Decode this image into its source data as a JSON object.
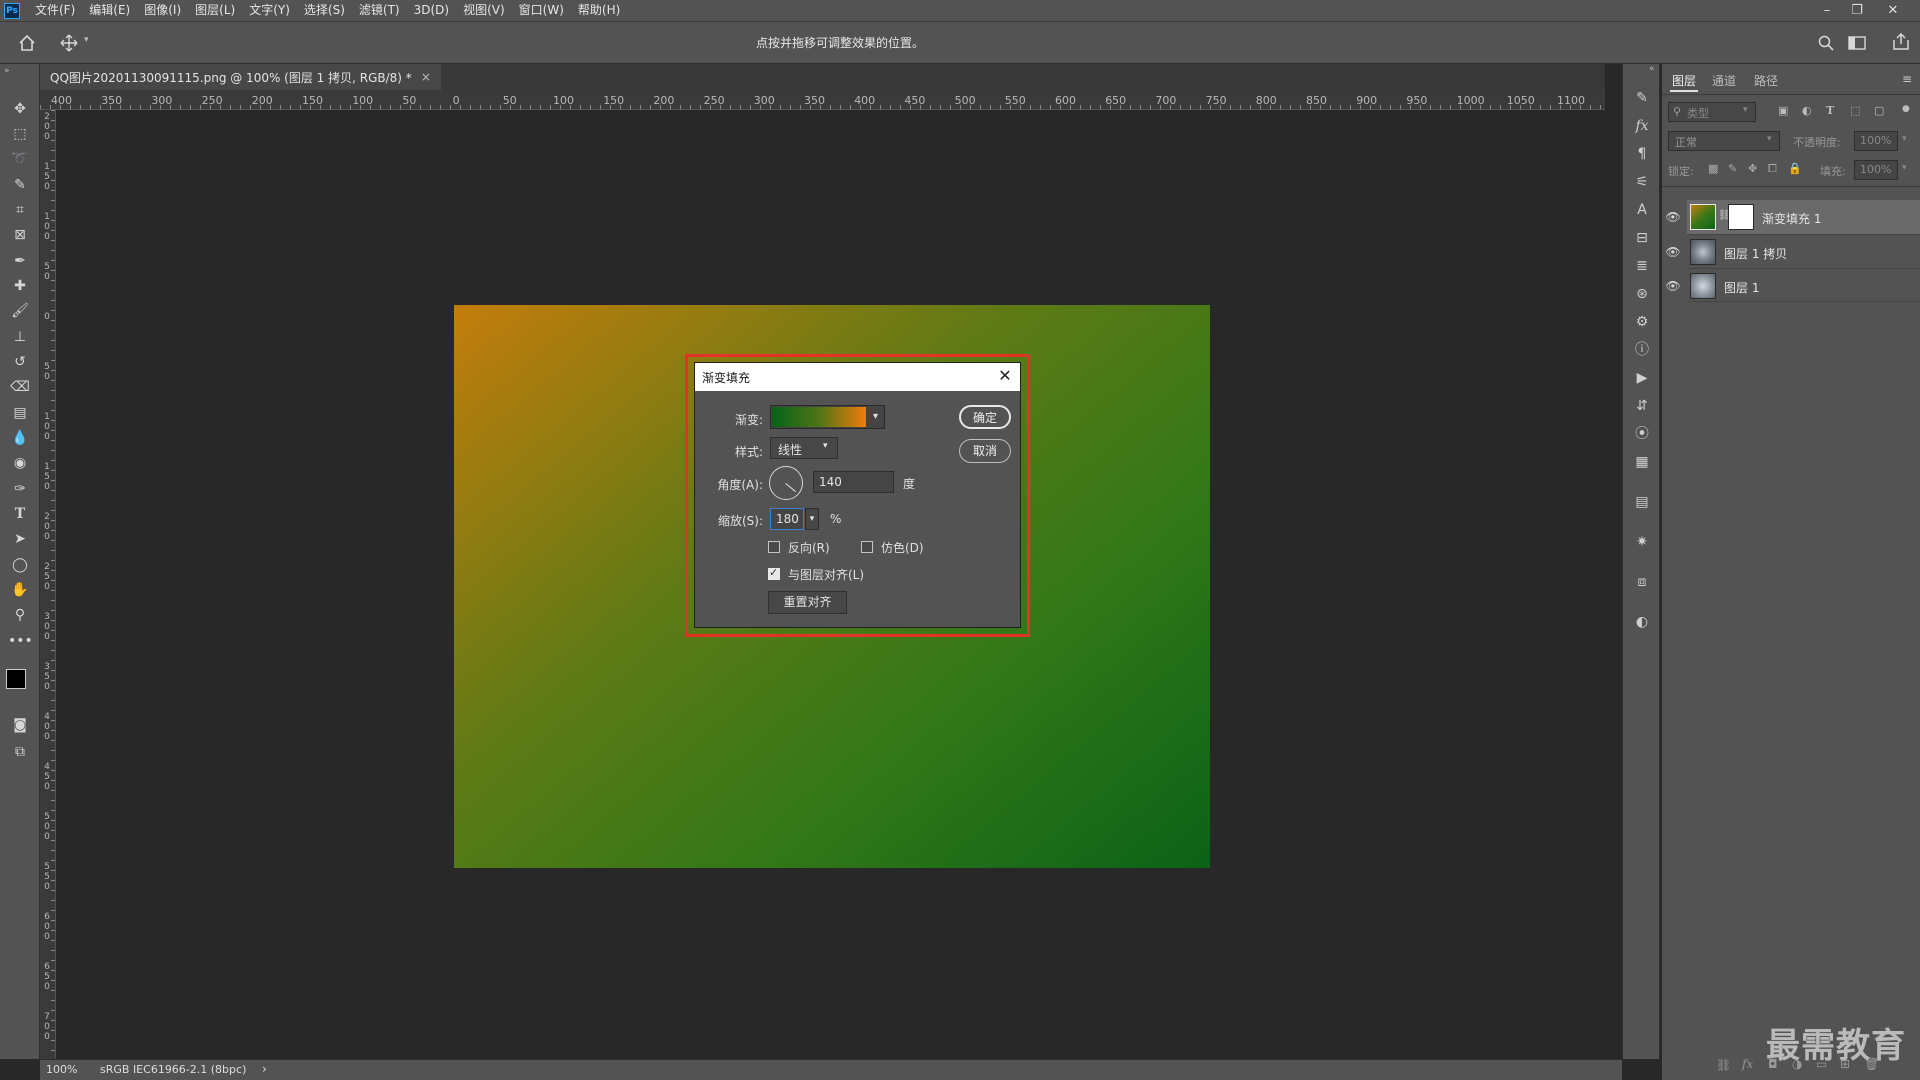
{
  "app": {
    "logo": "Ps",
    "menu": [
      "文件(F)",
      "编辑(E)",
      "图像(I)",
      "图层(L)",
      "文字(Y)",
      "选择(S)",
      "滤镜(T)",
      "3D(D)",
      "视图(V)",
      "窗口(W)",
      "帮助(H)"
    ],
    "window_controls": [
      "–",
      "❐",
      "✕"
    ]
  },
  "options_bar": {
    "hint": "点按并拖移可调整效果的位置。"
  },
  "document": {
    "tab_label": "QQ图片20201130091115.png @ 100% (图层 1 拷贝, RGB/8) *",
    "tab_close": "×",
    "ruler_h_labels": [
      "400",
      "350",
      "300",
      "250",
      "200",
      "150",
      "100",
      "50",
      "0",
      "50",
      "100",
      "150",
      "200",
      "250",
      "300",
      "350",
      "400",
      "450",
      "500",
      "550",
      "600",
      "650",
      "700",
      "750",
      "800",
      "850",
      "900",
      "950",
      "1000",
      "1050",
      "1100"
    ],
    "ruler_v_labels": [
      "200",
      "150",
      "100",
      "50",
      "0",
      "50",
      "100",
      "150",
      "200",
      "250",
      "300",
      "350",
      "400",
      "450",
      "500",
      "550",
      "600",
      "650",
      "700"
    ]
  },
  "dialog": {
    "title": "渐变填充",
    "close": "✕",
    "gradient_label": "渐变:",
    "style_label": "样式:",
    "style_value": "线性",
    "angle_label": "角度(A):",
    "angle_value": "140",
    "angle_unit": "度",
    "scale_label": "缩放(S):",
    "scale_value": "180",
    "scale_unit": "%",
    "reverse_label": "反向(R)",
    "reverse_checked": false,
    "dither_label": "仿色(D)",
    "dither_checked": false,
    "align_label": "与图层对齐(L)",
    "align_checked": true,
    "reset_button": "重置对齐",
    "ok_button": "确定",
    "cancel_button": "取消",
    "gradient_colors": [
      "#046419",
      "#f07d09"
    ]
  },
  "layers_panel": {
    "tabs": [
      "图层",
      "通道",
      "路径"
    ],
    "filter_placeholder": "类型",
    "blend_mode": "正常",
    "opacity_label": "不透明度:",
    "opacity_value": "100%",
    "lock_label": "锁定:",
    "fill_label": "填充:",
    "fill_value": "100%",
    "layers": [
      {
        "name": "渐变填充 1",
        "selected": true
      },
      {
        "name": "图层 1 拷贝",
        "selected": false
      },
      {
        "name": "图层 1",
        "selected": false
      }
    ]
  },
  "status_bar": {
    "zoom": "100%",
    "profile": "sRGB IEC61966-2.1 (8bpc)",
    "arrow": "›"
  },
  "watermark": "最需教育",
  "colors": {
    "highlight": "#e53227",
    "canvas_start": "#c47d0c",
    "canvas_end": "#0b6218"
  }
}
